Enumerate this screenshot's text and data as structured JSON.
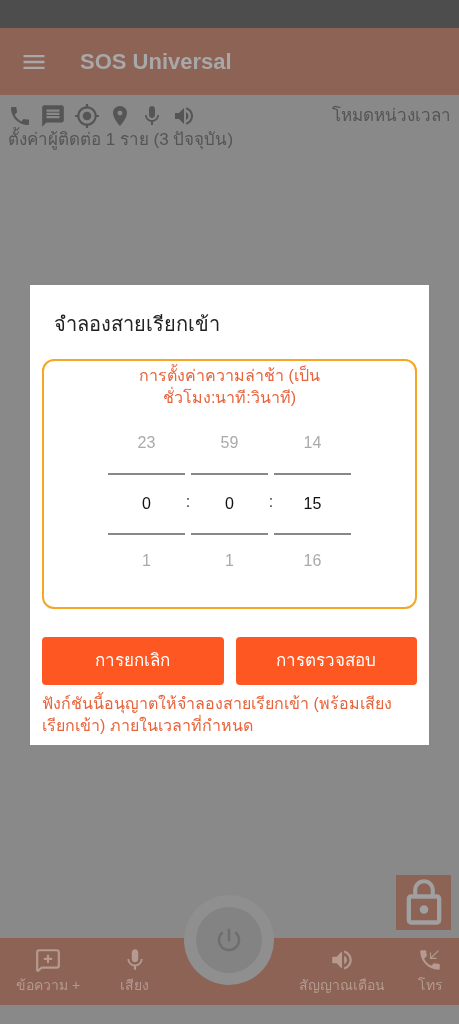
{
  "app_bar": {
    "title": "SOS Universal"
  },
  "status": {
    "mode": "โหมดหน่วงเวลา",
    "contacts": "ตั้งค่าผู้ติดต่อ 1 ราย (3 ปัจจุบัน)"
  },
  "dialog": {
    "title": "จำลองสายเรียกเข้า",
    "picker": {
      "caption": "การตั้งค่าความล่าช้า (เป็น ชั่วโมง:นาที:วินาที)",
      "columns": [
        {
          "above": "23",
          "value": "0",
          "below": "1",
          "separator": ":"
        },
        {
          "above": "59",
          "value": "0",
          "below": "1",
          "separator": ":"
        },
        {
          "above": "14",
          "value": "15",
          "below": "16"
        }
      ]
    },
    "buttons": [
      "การยกเลิก",
      "การตรวจสอบ"
    ],
    "note": "ฟังก์ชันนี้อนุญาตให้จำลองสายเรียกเข้า (พร้อมเสียงเรียกเข้า) ภายในเวลาที่กำหนด"
  },
  "bottom_nav": [
    {
      "kind": "message",
      "label": "ข้อความ +"
    },
    {
      "kind": "voice",
      "label": "เสียง"
    },
    {
      "kind": "alarm",
      "label": "สัญญาณเตือน"
    },
    {
      "kind": "call",
      "label": "โทร"
    }
  ]
}
